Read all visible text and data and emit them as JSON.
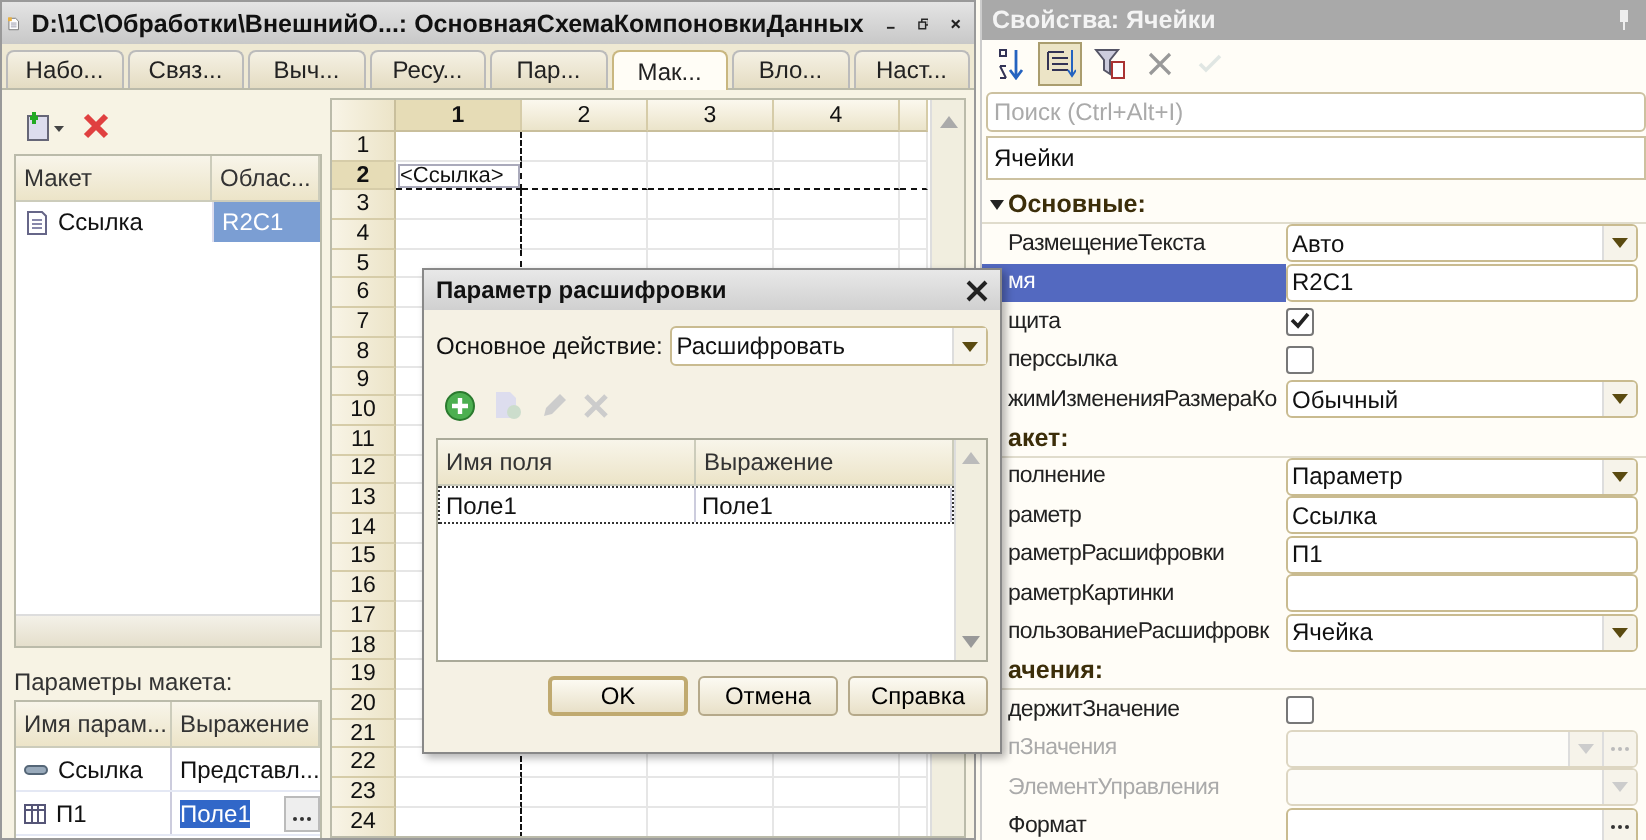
{
  "window": {
    "title": "D:\\1C\\Обработки\\ВнешнийО...: ОсновнаяСхемаКомпоновкиДанных"
  },
  "tabs": [
    {
      "label": "Набо...",
      "selected": false
    },
    {
      "label": "Связ...",
      "selected": false
    },
    {
      "label": "Выч...",
      "selected": false
    },
    {
      "label": "Ресу...",
      "selected": false
    },
    {
      "label": "Пар...",
      "selected": false
    },
    {
      "label": "Мак...",
      "selected": true
    },
    {
      "label": "Вло...",
      "selected": false
    },
    {
      "label": "Наст...",
      "selected": false
    }
  ],
  "layouts": {
    "columns": [
      "Макет",
      "Облас..."
    ],
    "rows": [
      {
        "name": "Ссылка",
        "area": "R2C1",
        "selected": true
      }
    ]
  },
  "layout_params": {
    "title": "Параметры макета:",
    "columns": [
      "Имя парам...",
      "Выражение"
    ],
    "rows": [
      {
        "kind": "value",
        "name": "Ссылка",
        "expression": "Представл...",
        "selected": false
      },
      {
        "kind": "table",
        "name": "П1",
        "expression": "Поле1",
        "selected": true
      }
    ]
  },
  "spreadsheet": {
    "columns": [
      {
        "label": "1",
        "selected": true
      },
      {
        "label": "2",
        "selected": false
      },
      {
        "label": "3",
        "selected": false
      },
      {
        "label": "4",
        "selected": false
      }
    ],
    "rows": [
      {
        "number": "1",
        "selected": false
      },
      {
        "number": "2",
        "selected": true,
        "cells": [
          "<Ссылка>"
        ]
      },
      {
        "number": "3",
        "selected": false
      },
      {
        "number": "4",
        "selected": false
      },
      {
        "number": "5",
        "selected": false
      },
      {
        "number": "6",
        "selected": false
      },
      {
        "number": "7",
        "selected": false
      },
      {
        "number": "8",
        "selected": false
      },
      {
        "number": "9",
        "selected": false
      },
      {
        "number": "10",
        "selected": false
      },
      {
        "number": "11",
        "selected": false
      },
      {
        "number": "12",
        "selected": false
      },
      {
        "number": "13",
        "selected": false
      },
      {
        "number": "14",
        "selected": false
      },
      {
        "number": "15",
        "selected": false
      },
      {
        "number": "16",
        "selected": false
      },
      {
        "number": "17",
        "selected": false
      },
      {
        "number": "18",
        "selected": false
      },
      {
        "number": "19",
        "selected": false
      },
      {
        "number": "20",
        "selected": false
      },
      {
        "number": "21",
        "selected": false
      },
      {
        "number": "22",
        "selected": false
      },
      {
        "number": "23",
        "selected": false
      },
      {
        "number": "24",
        "selected": false
      }
    ]
  },
  "dialog": {
    "title": "Параметр расшифровки",
    "action_label": "Основное действие:",
    "action_value": "Расшифровать",
    "toolbar": [
      {
        "kind": "add",
        "disabled": false
      },
      {
        "kind": "copy",
        "disabled": true
      },
      {
        "kind": "edit",
        "disabled": true
      },
      {
        "kind": "delete",
        "disabled": true
      }
    ],
    "columns": [
      "Имя поля",
      "Выражение"
    ],
    "rows": [
      {
        "field": "Поле1",
        "expression": "Поле1",
        "focused": true
      }
    ],
    "buttons": [
      {
        "label": "OK",
        "default": true
      },
      {
        "label": "Отмена",
        "default": false
      },
      {
        "label": "Справка",
        "default": false
      }
    ]
  },
  "properties": {
    "title": "Свойства: Ячейки",
    "search_placeholder": "Поиск (Ctrl+Alt+I)",
    "object": "Ячейки",
    "toolbar": [
      {
        "kind": "sort",
        "pressed": false,
        "disabled": false
      },
      {
        "kind": "tree",
        "pressed": true,
        "disabled": false
      },
      {
        "kind": "filter",
        "pressed": false,
        "disabled": false
      },
      {
        "kind": "cancel",
        "pressed": false,
        "disabled": false
      },
      {
        "kind": "ok",
        "pressed": false,
        "disabled": true
      }
    ],
    "rows": [
      {
        "kind": "section",
        "label": "Основные:",
        "expanded": true
      },
      {
        "kind": "dropdown",
        "label": "РазмещениеТекста",
        "value": "Авто",
        "selected": false,
        "disabled": false
      },
      {
        "kind": "text",
        "label": "мя",
        "value": "R2C1",
        "selected": true,
        "disabled": false
      },
      {
        "kind": "checkbox",
        "label": "щита",
        "checked": true,
        "selected": false,
        "disabled": false
      },
      {
        "kind": "checkbox",
        "label": "перссылка",
        "checked": false,
        "selected": false,
        "disabled": false
      },
      {
        "kind": "dropdown",
        "label": "жимИзмененияРазмераКо",
        "value": "Обычный",
        "selected": false,
        "disabled": false
      },
      {
        "kind": "section",
        "label": "акет:"
      },
      {
        "kind": "dropdown",
        "label": "полнение",
        "value": "Параметр",
        "selected": false,
        "disabled": false
      },
      {
        "kind": "text",
        "label": "раметр",
        "value": "Ссылка",
        "selected": false,
        "disabled": false
      },
      {
        "kind": "text",
        "label": "раметрРасшифровки",
        "value": "П1",
        "selected": false,
        "disabled": false
      },
      {
        "kind": "text",
        "label": "раметрКартинки",
        "selected": false,
        "disabled": false
      },
      {
        "kind": "dropdown",
        "label": "пользованиеРасшифровк",
        "value": "Ячейка",
        "selected": false,
        "disabled": false
      },
      {
        "kind": "section",
        "label": "ачения:"
      },
      {
        "kind": "checkbox",
        "label": "держитЗначение",
        "checked": false,
        "selected": false,
        "disabled": false
      },
      {
        "kind": "dropdown-ellipsis",
        "label": "пЗначения",
        "selected": false,
        "disabled": true
      },
      {
        "kind": "dropdown",
        "label": "ЭлементУправления",
        "selected": false,
        "disabled": true
      },
      {
        "kind": "text-ellipsis",
        "label": "Формат",
        "selected": false,
        "disabled": false
      }
    ]
  }
}
